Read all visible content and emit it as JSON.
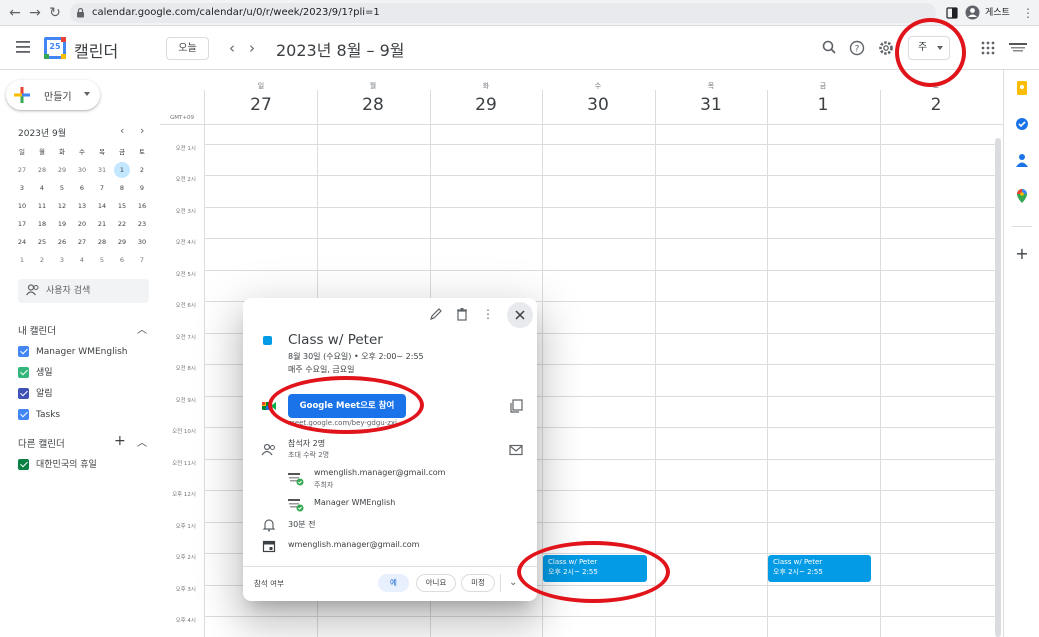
{
  "browser": {
    "url": "calendar.google.com/calendar/u/0/r/week/2023/9/1?pli=1",
    "profile_label": "게스트"
  },
  "header": {
    "app_name": "캘린더",
    "logo_number": "25",
    "today_label": "오늘",
    "range_title": "2023년 8월 – 9월",
    "view_label": "주"
  },
  "sidebar": {
    "create_label": "만들기",
    "mini_calendar": {
      "title": "2023년 9월",
      "weekdays": [
        "일",
        "월",
        "화",
        "수",
        "목",
        "금",
        "토"
      ],
      "weeks": [
        [
          "27",
          "28",
          "29",
          "30",
          "31",
          "1",
          "2"
        ],
        [
          "3",
          "4",
          "5",
          "6",
          "7",
          "8",
          "9"
        ],
        [
          "10",
          "11",
          "12",
          "13",
          "14",
          "15",
          "16"
        ],
        [
          "17",
          "18",
          "19",
          "20",
          "21",
          "22",
          "23"
        ],
        [
          "24",
          "25",
          "26",
          "27",
          "28",
          "29",
          "30"
        ],
        [
          "1",
          "2",
          "3",
          "4",
          "5",
          "6",
          "7"
        ]
      ]
    },
    "people_search_placeholder": "사용자 검색",
    "my_calendars_title": "내 캘린더",
    "my_calendars": [
      {
        "label": "Manager WMEnglish",
        "color": "#4285f4"
      },
      {
        "label": "생일",
        "color": "#33b679"
      },
      {
        "label": "알림",
        "color": "#3f51b5"
      },
      {
        "label": "Tasks",
        "color": "#4285f4"
      }
    ],
    "other_calendars_title": "다른 캘린더",
    "other_calendars": [
      {
        "label": "대한민국의 휴일",
        "color": "#0b8043"
      }
    ]
  },
  "grid": {
    "timezone": "GMT+09",
    "days": [
      {
        "dow": "일",
        "date": "27"
      },
      {
        "dow": "월",
        "date": "28"
      },
      {
        "dow": "화",
        "date": "29"
      },
      {
        "dow": "수",
        "date": "30"
      },
      {
        "dow": "목",
        "date": "31"
      },
      {
        "dow": "금",
        "date": "1"
      },
      {
        "dow": "토",
        "date": "2"
      }
    ],
    "hours": [
      "오전 1시",
      "오전 2시",
      "오전 3시",
      "오전 4시",
      "오전 5시",
      "오전 6시",
      "오전 7시",
      "오전 8시",
      "오전 9시",
      "오전 10시",
      "오전 11시",
      "오후 12시",
      "오후 1시",
      "오후 2시",
      "오후 3시",
      "오후 4시"
    ],
    "events": [
      {
        "title": "Class w/ Peter",
        "time": "오후 2시~ 2:55",
        "color": "#039be5"
      },
      {
        "title": "Class w/ Peter",
        "time": "오후 2시~ 2:55",
        "color": "#039be5"
      }
    ]
  },
  "popup": {
    "title": "Class w/ Peter",
    "date_line": "8월 30일 (수요일) • 오후 2:00~ 2:55",
    "recurrence": "매주 수요일, 금요일",
    "meet_button": "Google Meet으로 참여",
    "meet_link": "meet.google.com/bey-gdgu-zxj",
    "guests_summary": "참석자 2명",
    "guests_status": "초대 수락 2명",
    "guests": [
      {
        "name": "wmenglish.manager@gmail.com",
        "role": "주최자"
      },
      {
        "name": "Manager WMEnglish",
        "role": ""
      }
    ],
    "reminder": "30분 전",
    "organizer_calendar": "wmenglish.manager@gmail.com",
    "rsvp_label": "참석 여부",
    "rsvp_options": [
      "예",
      "아니요",
      "미정"
    ]
  }
}
